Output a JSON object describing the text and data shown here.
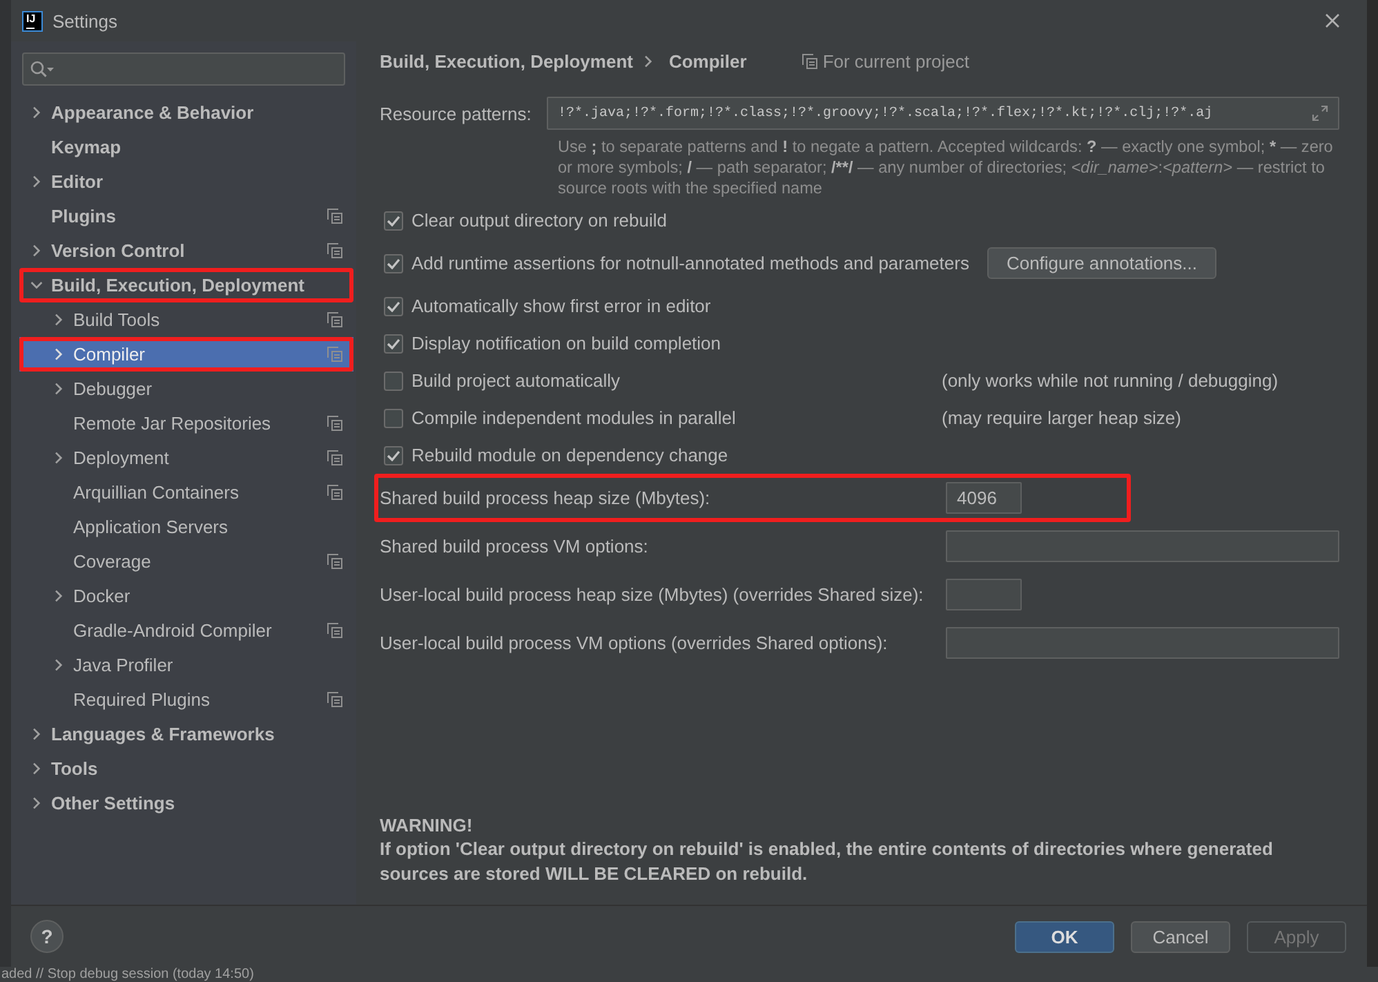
{
  "window": {
    "logo_text": "IJ",
    "title": "Settings"
  },
  "sidebar": {
    "items": [
      {
        "label": "Appearance & Behavior",
        "kind": "group",
        "expanded": false,
        "selected": false,
        "project_level": false,
        "annotated": false
      },
      {
        "label": "Keymap",
        "kind": "leaf",
        "selected": false,
        "project_level": false,
        "annotated": false
      },
      {
        "label": "Editor",
        "kind": "group",
        "expanded": false,
        "selected": false,
        "project_level": false,
        "annotated": false
      },
      {
        "label": "Plugins",
        "kind": "leaf",
        "selected": false,
        "project_level": true,
        "annotated": false
      },
      {
        "label": "Version Control",
        "kind": "group",
        "expanded": false,
        "selected": false,
        "project_level": true,
        "annotated": false
      },
      {
        "label": "Build, Execution, Deployment",
        "kind": "group",
        "expanded": true,
        "selected": false,
        "project_level": false,
        "annotated": true,
        "children": [
          {
            "label": "Build Tools",
            "kind": "group",
            "expanded": false,
            "selected": false,
            "project_level": true,
            "annotated": false
          },
          {
            "label": "Compiler",
            "kind": "group",
            "expanded": false,
            "selected": true,
            "project_level": true,
            "annotated": true
          },
          {
            "label": "Debugger",
            "kind": "group",
            "expanded": false,
            "selected": false,
            "project_level": false,
            "annotated": false
          },
          {
            "label": "Remote Jar Repositories",
            "kind": "leaf",
            "selected": false,
            "project_level": true,
            "annotated": false
          },
          {
            "label": "Deployment",
            "kind": "group",
            "expanded": false,
            "selected": false,
            "project_level": true,
            "annotated": false
          },
          {
            "label": "Arquillian Containers",
            "kind": "leaf",
            "selected": false,
            "project_level": true,
            "annotated": false
          },
          {
            "label": "Application Servers",
            "kind": "leaf",
            "selected": false,
            "project_level": false,
            "annotated": false
          },
          {
            "label": "Coverage",
            "kind": "leaf",
            "selected": false,
            "project_level": true,
            "annotated": false
          },
          {
            "label": "Docker",
            "kind": "group",
            "expanded": false,
            "selected": false,
            "project_level": false,
            "annotated": false
          },
          {
            "label": "Gradle-Android Compiler",
            "kind": "leaf",
            "selected": false,
            "project_level": true,
            "annotated": false
          },
          {
            "label": "Java Profiler",
            "kind": "group",
            "expanded": false,
            "selected": false,
            "project_level": false,
            "annotated": false
          },
          {
            "label": "Required Plugins",
            "kind": "leaf",
            "selected": false,
            "project_level": true,
            "annotated": false
          }
        ]
      },
      {
        "label": "Languages & Frameworks",
        "kind": "group",
        "expanded": false,
        "selected": false,
        "project_level": false,
        "annotated": false
      },
      {
        "label": "Tools",
        "kind": "group",
        "expanded": false,
        "selected": false,
        "project_level": false,
        "annotated": false
      },
      {
        "label": "Other Settings",
        "kind": "group",
        "expanded": false,
        "selected": false,
        "project_level": false,
        "annotated": false
      }
    ]
  },
  "breadcrumb": {
    "path": [
      "Build, Execution, Deployment",
      "Compiler"
    ],
    "scope_label": "For current project"
  },
  "compiler": {
    "resource_patterns": {
      "label": "Resource patterns:",
      "value": "!?*.java;!?*.form;!?*.class;!?*.groovy;!?*.scala;!?*.flex;!?*.kt;!?*.clj;!?*.aj",
      "hint": [
        {
          "text": "Use ",
          "kind": "prose"
        },
        {
          "text": ";",
          "kind": "symbol"
        },
        {
          "text": " to separate patterns and ",
          "kind": "prose"
        },
        {
          "text": "!",
          "kind": "symbol"
        },
        {
          "text": " to negate a pattern. Accepted wildcards: ",
          "kind": "prose"
        },
        {
          "text": "?",
          "kind": "symbol"
        },
        {
          "text": " — exactly one symbol; ",
          "kind": "prose"
        },
        {
          "text": "*",
          "kind": "symbol"
        },
        {
          "text": " — zero or more symbols; ",
          "kind": "prose"
        },
        {
          "text": "/",
          "kind": "symbol"
        },
        {
          "text": " — path separator; ",
          "kind": "prose"
        },
        {
          "text": "/**/",
          "kind": "symbol"
        },
        {
          "text": " — any number of directories; ",
          "kind": "prose"
        },
        {
          "text": "<dir_name>",
          "kind": "placeholder"
        },
        {
          "text": ":",
          "kind": "prose"
        },
        {
          "text": "<pattern>",
          "kind": "placeholder"
        },
        {
          "text": " — restrict to source roots with the specified name",
          "kind": "prose"
        }
      ]
    },
    "options": [
      {
        "label": "Clear output directory on rebuild",
        "checked": true
      },
      {
        "label": "Add runtime assertions for notnull-annotated methods and parameters",
        "checked": true,
        "button": "Configure annotations..."
      },
      {
        "label": "Automatically show first error in editor",
        "checked": true
      },
      {
        "label": "Display notification on build completion",
        "checked": true
      },
      {
        "label": "Build project automatically",
        "checked": false,
        "note": "(only works while not running / debugging)"
      },
      {
        "label": "Compile independent modules in parallel",
        "checked": false,
        "note": "(may require larger heap size)"
      },
      {
        "label": "Rebuild module on dependency change",
        "checked": true
      }
    ],
    "fields": [
      {
        "label": "Shared build process heap size (Mbytes):",
        "kind": "number",
        "value": "4096",
        "annotated": true
      },
      {
        "label": "Shared build process VM options:",
        "kind": "text",
        "annotated": false
      },
      {
        "label": "User-local build process heap size (Mbytes) (overrides Shared size):",
        "kind": "number",
        "annotated": false
      },
      {
        "label": "User-local build process VM options (overrides Shared options):",
        "kind": "text",
        "annotated": false
      }
    ],
    "warning": {
      "title": "WARNING!",
      "text": "If option 'Clear output directory on rebuild' is enabled, the entire contents of directories where generated sources are stored WILL BE CLEARED on rebuild."
    }
  },
  "footer": {
    "help": "?",
    "buttons": [
      {
        "label": "OK",
        "kind": "default",
        "disabled": false
      },
      {
        "label": "Cancel",
        "kind": "normal",
        "disabled": false
      },
      {
        "label": "Apply",
        "kind": "normal",
        "disabled": true
      }
    ]
  },
  "status_bar": {
    "text": "aded // Stop debug session (today 14:50)"
  }
}
